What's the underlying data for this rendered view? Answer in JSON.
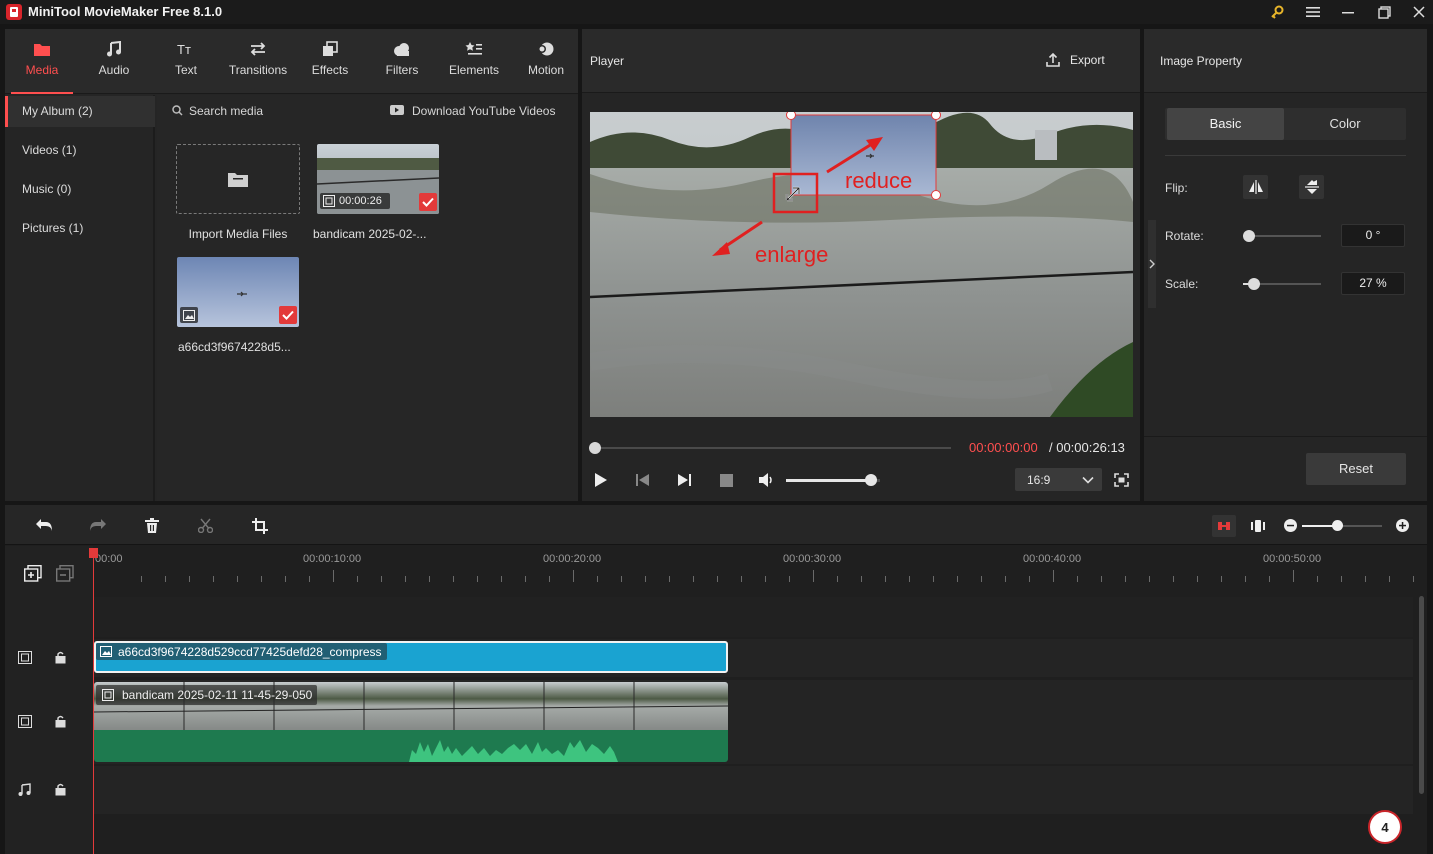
{
  "app": {
    "title": "MiniTool MovieMaker Free 8.1.0"
  },
  "toolbar": [
    {
      "label": "Media",
      "icon": "folder-icon"
    },
    {
      "label": "Audio",
      "icon": "music-note-icon"
    },
    {
      "label": "Text",
      "icon": "text-icon"
    },
    {
      "label": "Transitions",
      "icon": "swap-arrows-icon"
    },
    {
      "label": "Effects",
      "icon": "effects-icon"
    },
    {
      "label": "Filters",
      "icon": "cloud-icon"
    },
    {
      "label": "Elements",
      "icon": "stars-icon"
    },
    {
      "label": "Motion",
      "icon": "motion-icon"
    }
  ],
  "sidebar": [
    {
      "label": "My Album (2)"
    },
    {
      "label": "Videos (1)"
    },
    {
      "label": "Music (0)"
    },
    {
      "label": "Pictures (1)"
    }
  ],
  "search": {
    "label": "Search media",
    "download": "Download YouTube Videos"
  },
  "media": {
    "import_label": "Import Media Files",
    "video_label": "bandicam 2025-02-...",
    "video_duration": "00:00:26",
    "image_label": "a66cd3f9674228d5..."
  },
  "player": {
    "title": "Player",
    "export": "Export",
    "annotation_reduce": "reduce",
    "annotation_enlarge": "enlarge",
    "current_time": "00:00:00:00",
    "total_time": "/ 00:00:26:13",
    "aspect": "16:9",
    "progress": 0,
    "volume": 0.9
  },
  "property": {
    "title": "Image Property",
    "tab_basic": "Basic",
    "tab_color": "Color",
    "flip_label": "Flip:",
    "rotate_label": "Rotate:",
    "rotate_value": "0 °",
    "scale_label": "Scale:",
    "scale_value": "27 %",
    "reset": "Reset"
  },
  "timeline": {
    "ruler": [
      "00:00",
      "00:00:10:00",
      "00:00:20:00",
      "00:00:30:00",
      "00:00:40:00",
      "00:00:50:00"
    ],
    "image_clip": "a66cd3f9674228d529ccd77425defd28_compress",
    "video_clip": "bandicam 2025-02-11 11-45-29-050",
    "badge": "4"
  },
  "colors": {
    "accent": "#ff4f4f",
    "clip_image": "#1aa3d1",
    "clip_audio": "#1e7a4f"
  }
}
